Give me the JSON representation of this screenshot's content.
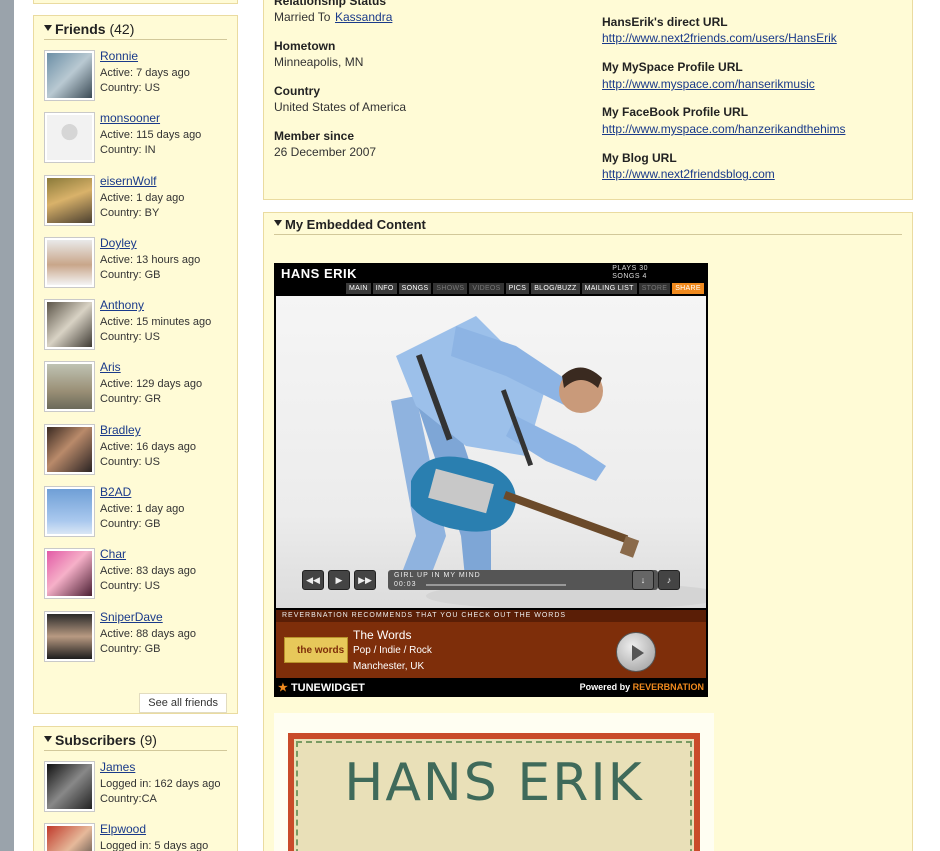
{
  "friends": {
    "title": "Friends",
    "count": "(42)",
    "see_all": "See all friends",
    "items": [
      {
        "name": "Ronnie",
        "active": "Active: 7 days ago",
        "country": "Country: US"
      },
      {
        "name": "monsooner",
        "active": "Active: 115 days ago",
        "country": "Country: IN"
      },
      {
        "name": "eisernWolf",
        "active": "Active: 1 day ago",
        "country": "Country: BY"
      },
      {
        "name": "Doyley",
        "active": "Active: 13 hours ago",
        "country": "Country: GB"
      },
      {
        "name": "Anthony",
        "active": "Active: 15 minutes ago",
        "country": "Country: US"
      },
      {
        "name": "Aris",
        "active": "Active: 129 days ago",
        "country": "Country: GR"
      },
      {
        "name": "Bradley",
        "active": "Active: 16 days ago",
        "country": "Country: US"
      },
      {
        "name": "B2AD",
        "active": "Active: 1 day ago",
        "country": "Country: GB"
      },
      {
        "name": "Char",
        "active": "Active: 83 days ago",
        "country": "Country: US"
      },
      {
        "name": "SniperDave",
        "active": "Active: 88 days ago",
        "country": "Country: GB"
      }
    ]
  },
  "subscribers": {
    "title": "Subscribers",
    "count": "(9)",
    "items": [
      {
        "name": "James",
        "logged": "Logged in: 162 days ago",
        "country": "Country:CA"
      },
      {
        "name": "Elpwood",
        "logged": "Logged in: 5 days ago",
        "country": ""
      }
    ]
  },
  "profile": {
    "relationship_label": "Relationship Status",
    "relationship_prefix": "Married To",
    "relationship_partner": "Kassandra",
    "hometown_label": "Hometown",
    "hometown": "Minneapolis, MN",
    "country_label": "Country",
    "country": "United States of America",
    "member_label": "Member since",
    "member_since": "26 December 2007",
    "direct_url_label": "HansErik's direct URL",
    "direct_url": "http://www.next2friends.com/users/HansErik",
    "myspace_label": "My MySpace Profile URL",
    "myspace_url": "http://www.myspace.com/hanserikmusic",
    "facebook_label": "My FaceBook Profile URL",
    "facebook_url": "http://www.myspace.com/hanzerikandthehims",
    "blog_label": "My Blog URL",
    "blog_url": "http://www.next2friendsblog.com"
  },
  "embedded": {
    "title": "My Embedded Content"
  },
  "widget": {
    "artist": "HANS ERIK",
    "plays": "PLAYS 30",
    "songs": "SONGS 4",
    "nav": [
      "MAIN",
      "INFO",
      "SONGS",
      "SHOWS",
      "VIDEOS",
      "PICS",
      "BLOG/BUZZ",
      "MAILING LIST",
      "STORE",
      "SHARE"
    ],
    "track_name": "GIRL UP IN MY MIND",
    "track_time": "00:03",
    "recommend": "REVERBNATION RECOMMENDS THAT YOU CHECK OUT THE WORDS",
    "band_logo": "the words",
    "band_name": "The Words",
    "band_genre": "Pop / Indie / Rock",
    "band_city": "Manchester, UK",
    "footer_left": "TUNEWIDGET",
    "footer_right_prefix": "Powered by",
    "footer_right_brand": "REVERBNATION"
  },
  "poster": {
    "title": "HANS ERIK"
  }
}
